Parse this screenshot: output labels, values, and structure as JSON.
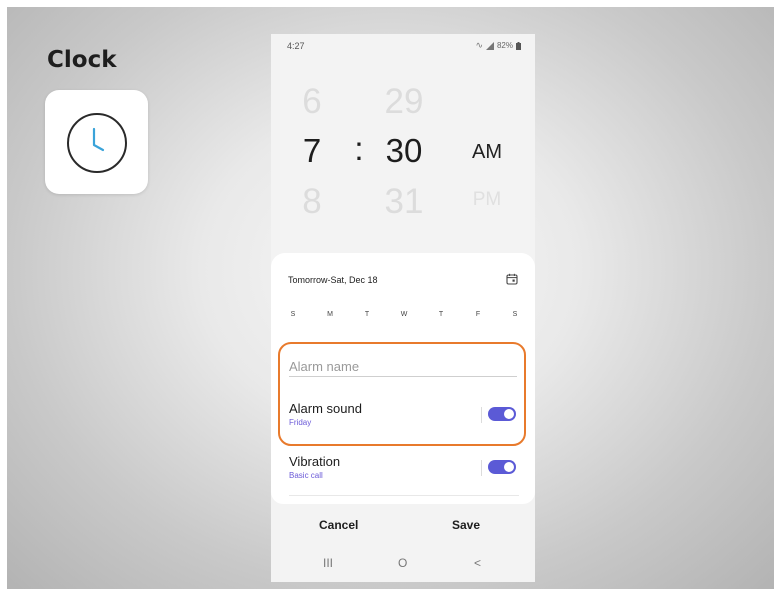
{
  "app": {
    "title": "Clock",
    "icon": "clock-icon"
  },
  "status_bar": {
    "time": "4:27",
    "battery": "82%",
    "icons": [
      "wifi-icon",
      "signal-icon",
      "battery-icon"
    ]
  },
  "picker": {
    "hours": {
      "prev": "6",
      "current": "7",
      "next": "8"
    },
    "minutes": {
      "prev": "29",
      "current": "30",
      "next": "31"
    },
    "separator": ":",
    "am": "AM",
    "pm": "PM",
    "selected_period": "AM"
  },
  "schedule": {
    "date_label": "Tomorrow-Sat, Dec 18",
    "calendar_icon": "calendar-icon",
    "days": [
      "S",
      "M",
      "T",
      "W",
      "T",
      "F",
      "S"
    ]
  },
  "alarm_name": {
    "placeholder": "Alarm name"
  },
  "settings": [
    {
      "title": "Alarm sound",
      "subtitle": "Friday",
      "enabled": true
    },
    {
      "title": "Vibration",
      "subtitle": "Basic call",
      "enabled": true
    }
  ],
  "actions": {
    "cancel": "Cancel",
    "save": "Save"
  },
  "nav": {
    "recents": "III",
    "home": "O",
    "back": "<"
  },
  "colors": {
    "accent": "#5b5ad6",
    "highlight": "#e87a2c"
  }
}
